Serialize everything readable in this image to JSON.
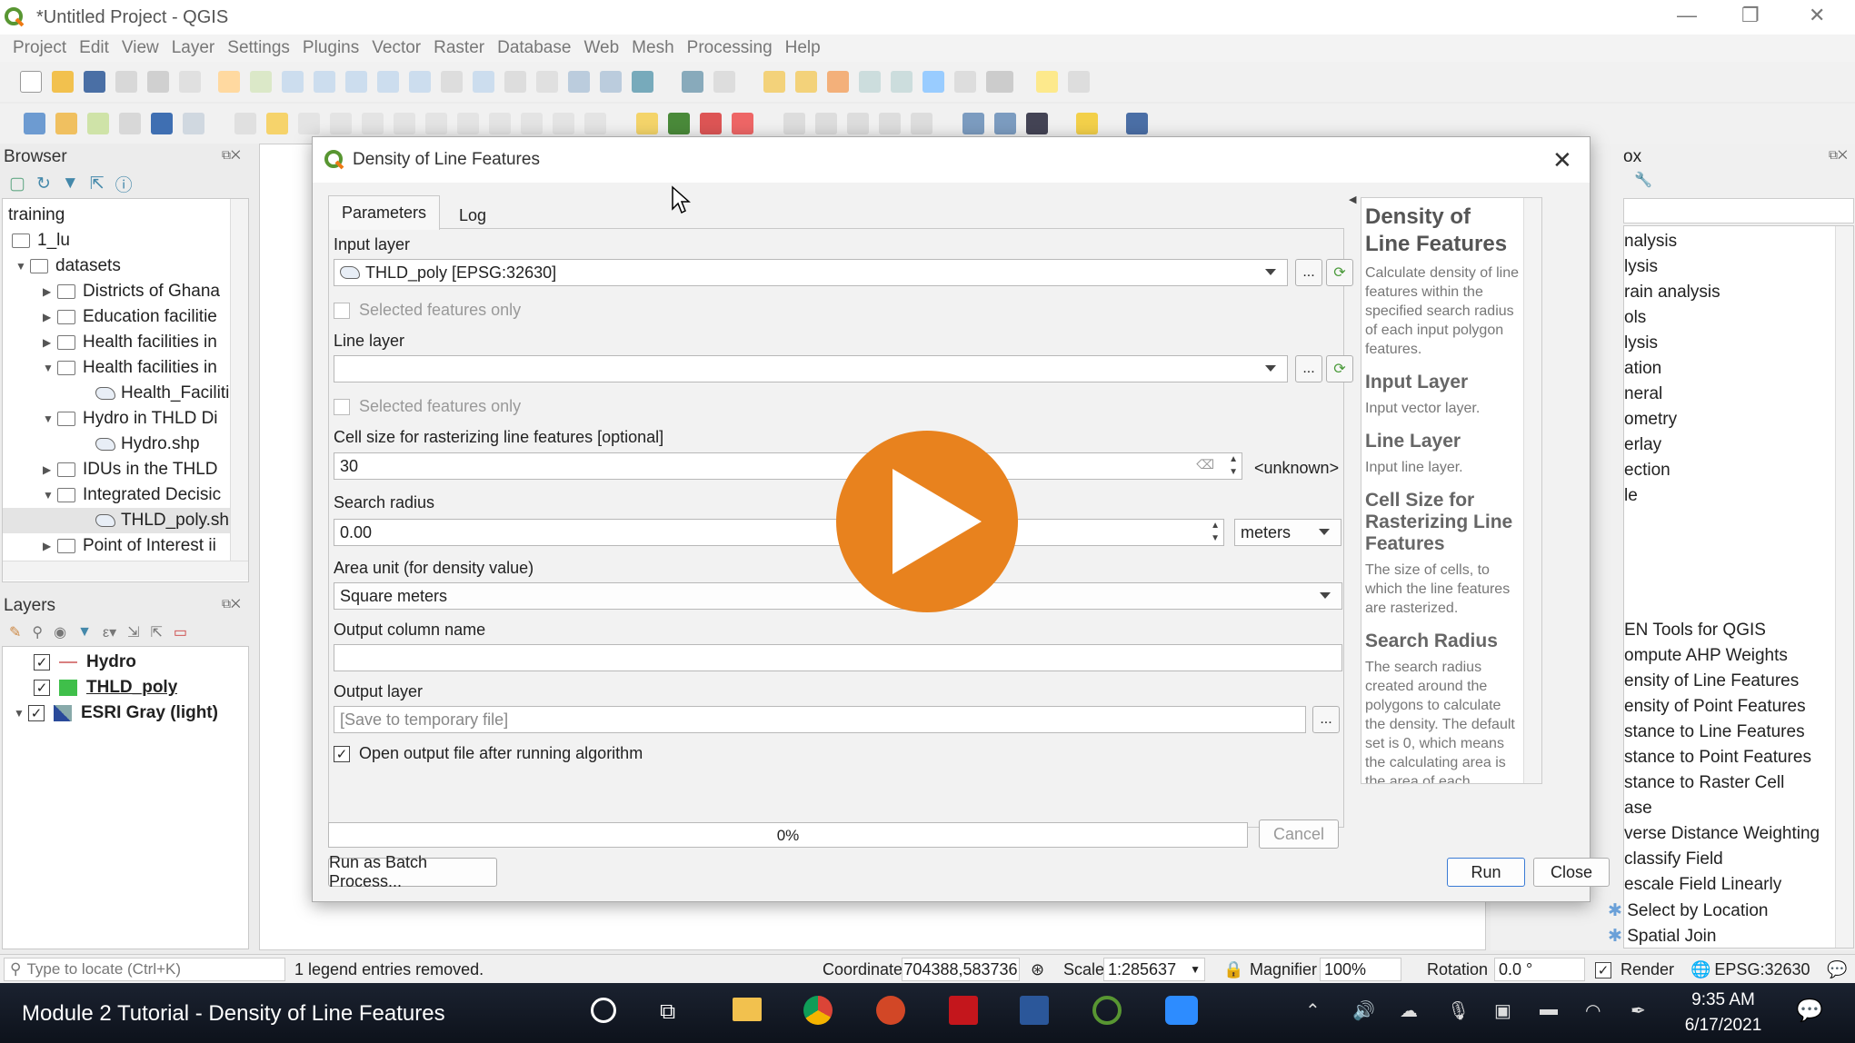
{
  "window": {
    "title": "*Untitled Project - QGIS"
  },
  "menu": [
    "Project",
    "Edit",
    "View",
    "Layer",
    "Settings",
    "Plugins",
    "Vector",
    "Raster",
    "Database",
    "Web",
    "Mesh",
    "Processing",
    "Help"
  ],
  "browser": {
    "title": "Browser",
    "items": [
      {
        "label": "training"
      },
      {
        "label": "1_lu"
      },
      {
        "label": "datasets"
      },
      {
        "label": "Districts of Ghana"
      },
      {
        "label": "Education facilitie"
      },
      {
        "label": "Health facilities in"
      },
      {
        "label": "Health facilities in"
      },
      {
        "label": "Health_Faciliti"
      },
      {
        "label": "Hydro in THLD Di"
      },
      {
        "label": "Hydro.shp"
      },
      {
        "label": "IDUs in the THLD"
      },
      {
        "label": "Integrated Decisic"
      },
      {
        "label": "THLD_poly.sh"
      },
      {
        "label": "Point of Interest ii"
      }
    ]
  },
  "layers": {
    "title": "Layers",
    "items": [
      {
        "label": "Hydro",
        "color": "#d98080"
      },
      {
        "label": "THLD_poly",
        "color": "#3fbf4a"
      },
      {
        "label": "ESRI Gray (light)",
        "color": "#2a4a9a"
      }
    ]
  },
  "dialog": {
    "title": "Density of Line Features",
    "tabs": [
      "Parameters",
      "Log"
    ],
    "input_layer_label": "Input layer",
    "input_layer_value": "THLD_poly [EPSG:32630]",
    "selected_only": "Selected features only",
    "line_layer_label": "Line layer",
    "line_layer_value": "",
    "selected_only_2": "Selected features only",
    "cell_size_label": "Cell size for rasterizing line features [optional]",
    "cell_size_value": "30",
    "cell_unit": "<unknown>",
    "search_radius_label": "Search radius",
    "search_radius_value": "0.00",
    "search_radius_unit": "meters",
    "area_unit_label": "Area unit (for density value)",
    "area_unit_value": "Square meters",
    "output_col_label": "Output column name",
    "output_col_value": "",
    "output_layer_label": "Output layer",
    "output_layer_placeholder": "[Save to temporary file]",
    "open_output": "Open output file after running algorithm",
    "more": "...",
    "progress_text": "0%",
    "progress": 0,
    "cancel": "Cancel",
    "batch": "Run as Batch Process...",
    "run": "Run",
    "close": "Close"
  },
  "help": {
    "title": "Density of Line Features",
    "intro": "Calculate density of line features within the specified search radius of each input polygon features.",
    "sections": [
      {
        "h": "Input Layer",
        "p": "Input vector layer."
      },
      {
        "h": "Line Layer",
        "p": "Input line layer."
      },
      {
        "h": "Cell Size for Rasterizing Line Features",
        "p": "The size of cells, to which the line features are rasterized."
      },
      {
        "h": "Search Radius",
        "p": "The search radius created around the polygons to calculate the density. The default set is 0, which means the calculating area is the area of each polygon feature. Units need to be specified."
      }
    ]
  },
  "toolbox": {
    "title_fragment": "ox",
    "items": [
      "nalysis",
      "lysis",
      "rain analysis",
      "ols",
      "lysis",
      "ation",
      "neral",
      "ometry",
      "erlay",
      "ection",
      "le",
      "EN Tools for QGIS",
      "ompute AHP Weights",
      "ensity of Line Features",
      "ensity of Point Features",
      "stance to Line Features",
      "stance to Point Features",
      "stance to Raster Cell",
      "ase",
      "verse Distance Weighting",
      "classify Field",
      "escale Field Linearly",
      "Select by Location",
      "Spatial Join"
    ]
  },
  "status": {
    "locate_placeholder": "Type to locate (Ctrl+K)",
    "message": "1 legend entries removed.",
    "coordinate_label": "Coordinate",
    "coordinate": "704388,583736",
    "scale_label": "Scale",
    "scale": "1:285637",
    "magnifier_label": "Magnifier",
    "magnifier": "100%",
    "rotation_label": "Rotation",
    "rotation": "0.0 °",
    "render": "Render",
    "crs": "EPSG:32630"
  },
  "taskbar": {
    "video_title": "Module 2 Tutorial - Density of Line Features",
    "time": "9:35 AM",
    "date": "6/17/2021"
  },
  "colors": {
    "play": "#e8821e",
    "accent": "#589632"
  }
}
